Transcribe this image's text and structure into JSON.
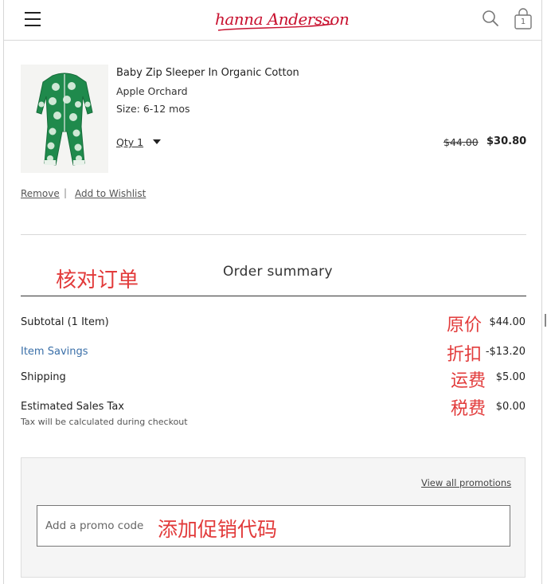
{
  "header": {
    "brand_name": "hanna Andersson",
    "bag_count": "1"
  },
  "product": {
    "name": "Baby Zip Sleeper In Organic Cotton",
    "color": "Apple Orchard",
    "size": "Size: 6-12 mos",
    "qty_label": "Qty 1",
    "price_original": "$44.00",
    "price_sale": "$30.80",
    "remove_label": "Remove",
    "separator": "|",
    "wishlist_label": "Add to Wishlist"
  },
  "summary": {
    "title": "Order summary",
    "rows": [
      {
        "label": "Subtotal (1 Item)",
        "value": "$44.00",
        "note": "原价"
      },
      {
        "label": "Item Savings",
        "value": "-$13.20",
        "note": "折扣"
      },
      {
        "label": "Shipping",
        "value": "$5.00",
        "note": "运费"
      },
      {
        "label": "Estimated Sales Tax",
        "value": "$0.00",
        "note": "税费"
      }
    ],
    "tax_note": "Tax will be calculated during checkout"
  },
  "annotations": {
    "review_order": "核对订单",
    "add_promo": "添加促销代码"
  },
  "promo": {
    "view_all_label": "View all promotions",
    "placeholder": "Add a promo code"
  },
  "colors": {
    "brand_red": "#c8102e",
    "annotation_red": "#e23b3b",
    "savings_blue": "#3a6fa8",
    "product_green": "#1f8a4c"
  }
}
